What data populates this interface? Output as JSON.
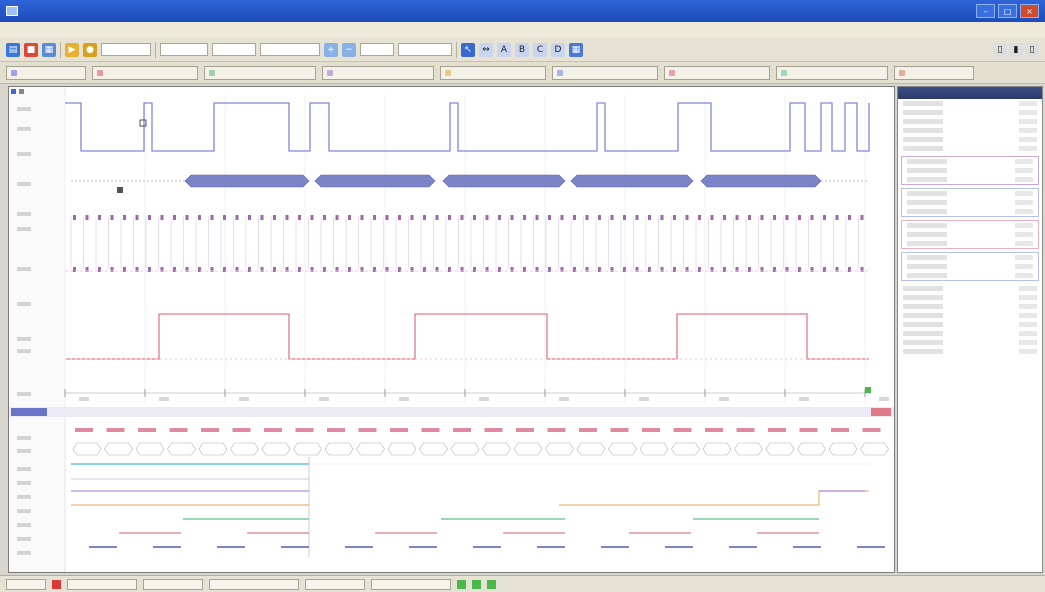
{
  "window": {
    "title": "",
    "minimize": "–",
    "maximize": "□",
    "close": "×"
  },
  "menu": {
    "items": [
      "",
      "",
      "",
      "",
      "",
      ""
    ]
  },
  "toolbar": {
    "icons": [
      "open-icon",
      "save-icon",
      "print-icon",
      "run-icon",
      "stop-icon",
      "zoom-in-icon",
      "zoom-out-icon",
      "cursor-icon",
      "measure-icon"
    ],
    "fields": [
      "",
      "",
      "",
      "",
      "",
      ""
    ]
  },
  "channel_bar": {
    "colors": [
      "#9aa4e6",
      "#e89aa0",
      "#9ad0a8",
      "#c8a8e0",
      "#e8c88a",
      "#a8b4e8",
      "#e8a0b0",
      "#a0d8c0",
      "#e0b090"
    ]
  },
  "side_panel": {
    "header": "",
    "rows": [
      {
        "label": "",
        "value": ""
      },
      {
        "label": "",
        "value": ""
      },
      {
        "label": "",
        "value": ""
      },
      {
        "label": "",
        "value": ""
      }
    ]
  },
  "status": {
    "boxes": [
      "",
      "",
      "",
      "",
      "",
      ""
    ]
  },
  "signals": {
    "clock_color": "#8088d8",
    "pink_color": "#e07a86",
    "bus_color": "#7c84c8",
    "bus2_color": "#c898c8",
    "cyan_color": "#8cd0e8",
    "green_color": "#7ccaa0",
    "orange_color": "#e6b87a",
    "lilac_color": "#b88ce0",
    "panel_accent": "#2a3a6c"
  }
}
